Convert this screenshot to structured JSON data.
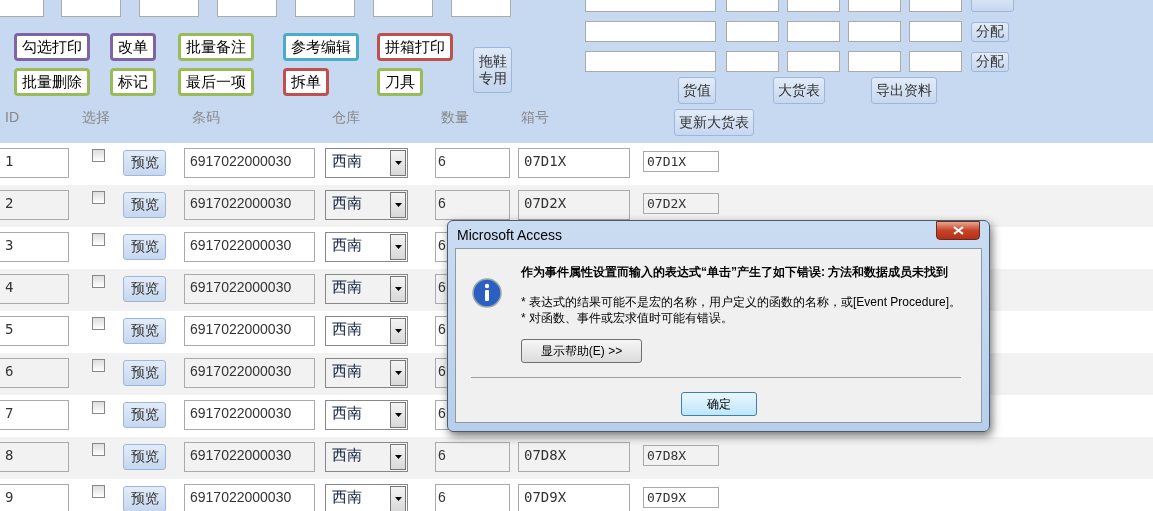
{
  "action_buttons": [
    [
      {
        "label": "勾选打印",
        "color": "#8064a2"
      },
      {
        "label": "改单",
        "color": "#8064a2"
      },
      {
        "label": "批量备注",
        "color": "#9bbb59"
      },
      {
        "label": "参考编辑",
        "color": "#4bacc6"
      },
      {
        "label": "拼箱打印",
        "color": "#c0504d"
      }
    ],
    [
      {
        "label": "批量删除",
        "color": "#9bbb59"
      },
      {
        "label": "标记",
        "color": "#9bbb59"
      },
      {
        "label": "最后一项",
        "color": "#9bbb59"
      },
      {
        "label": "拆单",
        "color": "#c0504d"
      },
      {
        "label": "刀具",
        "color": "#9bbb59"
      }
    ]
  ],
  "slipper_button": "拖鞋专用",
  "allocate_buttons": [
    "分配",
    "分配"
  ],
  "panel_buttons": [
    "货值",
    "大货表",
    "导出资料"
  ],
  "update_button": "更新大货表",
  "columns": [
    "ID",
    "选择",
    "条码",
    "仓库",
    "数量",
    "箱号"
  ],
  "rows": [
    {
      "id": "1",
      "checked": false,
      "preview": "预览",
      "barcode": "6917022000030",
      "warehouse": "西南",
      "qty": "6",
      "box": "07D1X",
      "extra": "07D1X"
    },
    {
      "id": "2",
      "checked": false,
      "preview": "预览",
      "barcode": "6917022000030",
      "warehouse": "西南",
      "qty": "6",
      "box": "07D2X",
      "extra": "07D2X"
    },
    {
      "id": "3",
      "checked": false,
      "preview": "预览",
      "barcode": "6917022000030",
      "warehouse": "西南",
      "qty": "6"
    },
    {
      "id": "4",
      "checked": false,
      "preview": "预览",
      "barcode": "6917022000030",
      "warehouse": "西南",
      "qty": "6"
    },
    {
      "id": "5",
      "checked": false,
      "preview": "预览",
      "barcode": "6917022000030",
      "warehouse": "西南",
      "qty": "6"
    },
    {
      "id": "6",
      "checked": false,
      "preview": "预览",
      "barcode": "6917022000030",
      "warehouse": "西南",
      "qty": "6"
    },
    {
      "id": "7",
      "checked": false,
      "preview": "预览",
      "barcode": "6917022000030",
      "warehouse": "西南",
      "qty": "6"
    },
    {
      "id": "8",
      "checked": false,
      "preview": "预览",
      "barcode": "6917022000030",
      "warehouse": "西南",
      "qty": "6",
      "box": "07D8X",
      "extra": "07D8X"
    },
    {
      "id": "9",
      "checked": false,
      "preview": "预览",
      "barcode": "6917022000030",
      "warehouse": "西南",
      "qty": "6",
      "box": "07D9X",
      "extra": "07D9X"
    }
  ],
  "dialog": {
    "title": "Microsoft Access",
    "heading": "作为事件属性设置而输入的表达式“单击”产生了如下错误: 方法和数据成员未找到",
    "notes": [
      "* 表达式的结果可能不是宏的名称，用户定义的函数的名称，或[Event Procedure]。",
      "* 对函数、事件或宏求值时可能有错误。"
    ],
    "help_button": "显示帮助(E) >>",
    "ok_button": "确定"
  }
}
